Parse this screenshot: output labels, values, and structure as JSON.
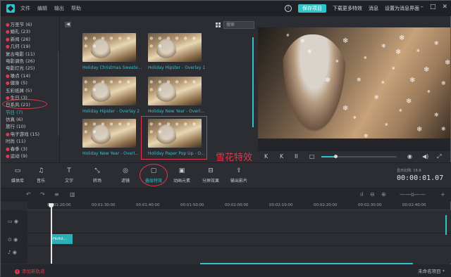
{
  "menu": [
    "文件",
    "编辑",
    "输出",
    "帮助"
  ],
  "header": {
    "save_label": "保存项目",
    "download_label": "下载更多特效",
    "messages_label": "消息",
    "settings_label": "设置为消息界面"
  },
  "categories": [
    {
      "label": "万圣节 (6)",
      "dot": true
    },
    {
      "label": "婚礼 (23)",
      "dot": true
    },
    {
      "label": "新闻 (26)",
      "dot": true
    },
    {
      "label": "几何 (19)",
      "dot": true
    },
    {
      "label": "复古电影 (11)",
      "dot": false
    },
    {
      "label": "电影调色 (26)",
      "dot": false
    },
    {
      "label": "电影灯光 (25)",
      "dot": false
    },
    {
      "label": "噪点 (14)",
      "dot": true
    },
    {
      "label": "健身 (5)",
      "dot": true
    },
    {
      "label": "五彩纸屑 (5)",
      "dot": false
    },
    {
      "label": "生日 (3)",
      "dot": true
    },
    {
      "label": "日系风 (21)",
      "dot": false
    },
    {
      "label": "节日 (7)",
      "dot": false
    },
    {
      "label": "仿真 (6)",
      "dot": false
    },
    {
      "label": "旅行 (10)",
      "dot": false
    },
    {
      "label": "电子游戏 (15)",
      "dot": true
    },
    {
      "label": "时尚 (11)",
      "dot": false
    },
    {
      "label": "春季 (3)",
      "dot": true
    },
    {
      "label": "运动 (9)",
      "dot": true
    }
  ],
  "gallery": {
    "search_placeholder": "搜索",
    "items": [
      {
        "label": "Holiday Christmas Sweate..."
      },
      {
        "label": "Holiday Hipster - Overlay 1"
      },
      {
        "label": "Holiday Hipster - Overlay 2"
      },
      {
        "label": "Holiday New Year - Overl..."
      },
      {
        "label": "Holiday New Year - Overl..."
      },
      {
        "label": "Holiday Paper Pop Up - O..."
      }
    ]
  },
  "annotation": "雪花特效",
  "toolbar": [
    {
      "label": "媒体库",
      "icon": "folder-icon"
    },
    {
      "label": "音乐",
      "icon": "music-icon"
    },
    {
      "label": "文字",
      "icon": "text-icon"
    },
    {
      "label": "转场",
      "icon": "transition-icon"
    },
    {
      "label": "滤镜",
      "icon": "filter-icon"
    },
    {
      "label": "叠层特效",
      "icon": "overlay-icon"
    },
    {
      "label": "动画元素",
      "icon": "elements-icon"
    },
    {
      "label": "分屏效果",
      "icon": "split-screen-icon"
    },
    {
      "label": "输出影片",
      "icon": "export-icon"
    }
  ],
  "preview": {
    "aspect_label": "显示比例: 16:9",
    "timecode": "00:00:01.07"
  },
  "timeline": {
    "ticks": [
      "00:01:20:00",
      "00:01:30:00",
      "00:01:40:00",
      "00:01:50:00",
      "00:02:00:00",
      "00:02:10:00",
      "00:02:20:00",
      "00:02:30:00",
      "00:02:40:00"
    ],
    "clip_label": "Holid..."
  },
  "footer": {
    "add_track_label": "添加新轨道",
    "project_label": "未命名项目 *"
  },
  "colors": {
    "accent": "#2ec4c9",
    "annotation": "#e0384e"
  }
}
